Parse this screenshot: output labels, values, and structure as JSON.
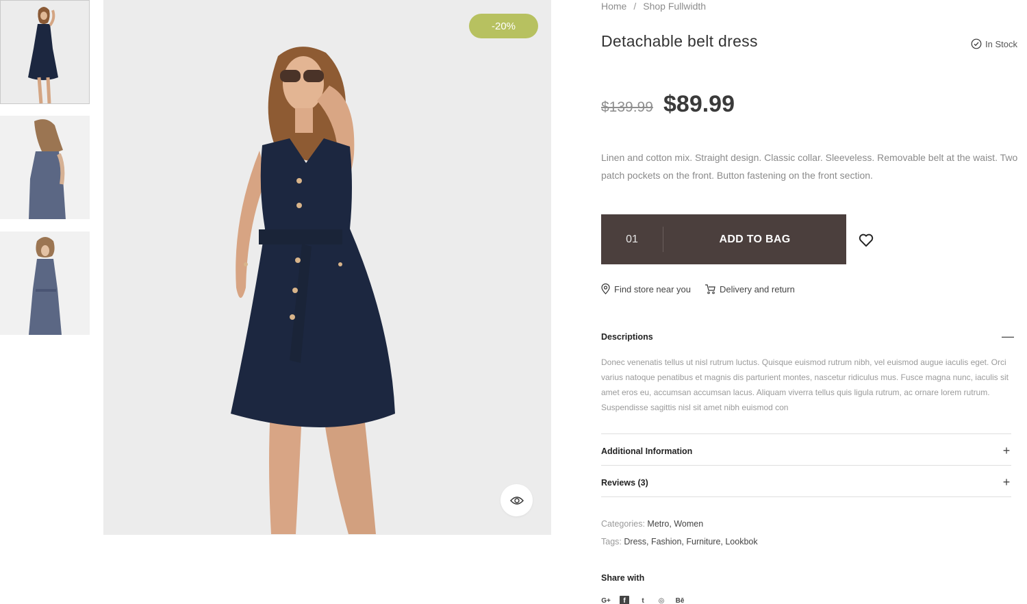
{
  "breadcrumb": {
    "home": "Home",
    "separator": "/",
    "current": "Shop Fullwidth"
  },
  "product": {
    "title": "Detachable belt dress",
    "stock": "In Stock",
    "old_price": "$139.99",
    "price": "$89.99",
    "discount_badge": "-20%",
    "short_description": "Linen and cotton mix. Straight design. Classic collar. Sleeveless. Removable belt at the waist. Two patch pockets on the front. Button fastening on the front section."
  },
  "cart": {
    "quantity": "01",
    "add_label": "ADD TO BAG"
  },
  "links": {
    "find_store": "Find store near you",
    "delivery": "Delivery and return"
  },
  "accordion": [
    {
      "title": "Descriptions",
      "toggle": "—",
      "expanded": true,
      "body": "Donec venenatis tellus ut nisl rutrum luctus. Quisque euismod rutrum nibh, vel euismod augue iaculis eget. Orci varius natoque penatibus et magnis dis parturient montes, nascetur ridiculus mus. Fusce magna nunc, iaculis sit amet eros eu, accumsan accumsan lacus. Aliquam viverra tellus quis ligula rutrum, ac ornare lorem rutrum. Suspendisse sagittis nisl sit amet nibh euismod con"
    },
    {
      "title": "Additional Information",
      "toggle": "+",
      "expanded": false
    },
    {
      "title": "Reviews (3)",
      "toggle": "+",
      "expanded": false
    }
  ],
  "meta": {
    "categories_label": "Categories:",
    "categories": "Metro, Women",
    "tags_label": "Tags:",
    "tags": "Dress, Fashion, Furniture, Lookbok"
  },
  "share": {
    "title": "Share with",
    "icons": [
      {
        "name": "google-plus-icon",
        "glyph": "G+"
      },
      {
        "name": "facebook-icon",
        "glyph": "f"
      },
      {
        "name": "twitter-icon",
        "glyph": "t"
      },
      {
        "name": "instagram-icon",
        "glyph": "◎"
      },
      {
        "name": "behance-icon",
        "glyph": "Bē"
      }
    ]
  },
  "colors": {
    "accent_badge": "#b7c160",
    "cart_bg": "#4b3f3d",
    "dress": "#1c2740"
  },
  "gallery": {
    "thumbnails": [
      "front-view",
      "back-view",
      "front-view-belted"
    ],
    "active_index": 0
  }
}
